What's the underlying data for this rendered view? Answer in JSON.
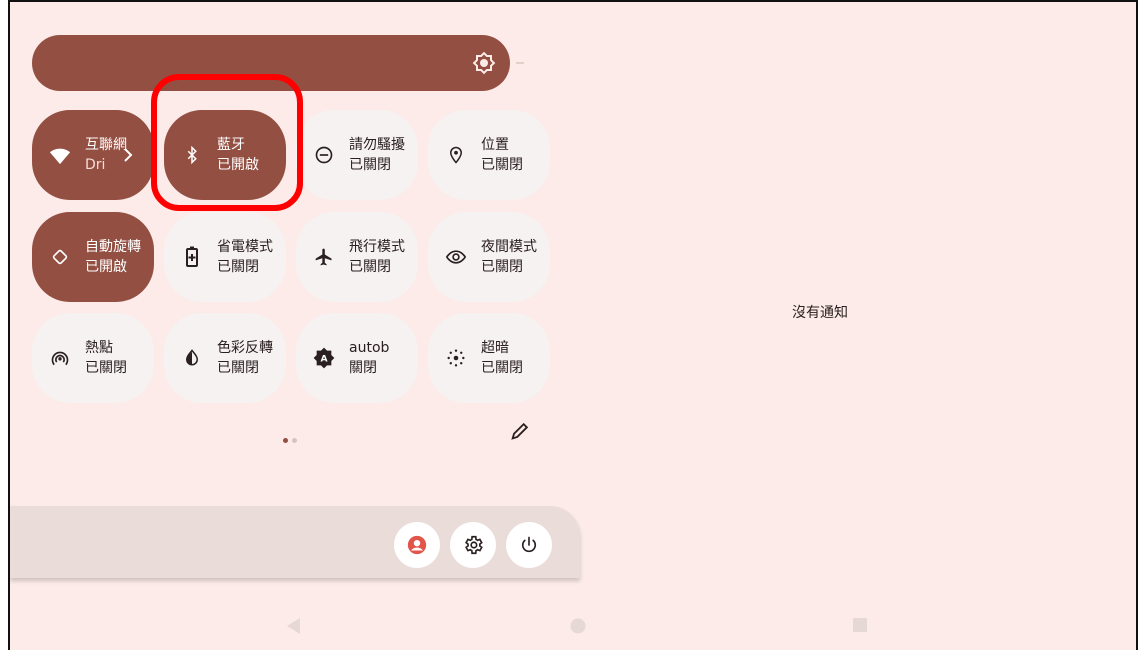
{
  "brightness": {
    "icon": "brightness-icon",
    "level": 1.0
  },
  "tiles": [
    {
      "id": "internet",
      "line1": "互聯網",
      "line2": "Dri",
      "state": "on",
      "icon": "wifi-icon",
      "has_chevron": true
    },
    {
      "id": "bluetooth",
      "line1": "藍牙",
      "line2": "已開啟",
      "state": "on",
      "icon": "bluetooth-icon"
    },
    {
      "id": "dnd",
      "line1": "請勿騷擾",
      "line2": "已關閉",
      "state": "off",
      "icon": "do-not-disturb-icon"
    },
    {
      "id": "location",
      "line1": "位置",
      "line2": "已關閉",
      "state": "off",
      "icon": "location-pin-icon"
    },
    {
      "id": "autorotate",
      "line1": "自動旋轉",
      "line2": "已開啟",
      "state": "on",
      "icon": "auto-rotate-icon"
    },
    {
      "id": "battery",
      "line1": "省電模式",
      "line2": "已關閉",
      "state": "off",
      "icon": "battery-saver-icon"
    },
    {
      "id": "airplane",
      "line1": "飛行模式",
      "line2": "已關閉",
      "state": "off",
      "icon": "airplane-icon"
    },
    {
      "id": "night",
      "line1": "夜間模式",
      "line2": "已關閉",
      "state": "off",
      "icon": "eye-icon"
    },
    {
      "id": "hotspot",
      "line1": "熱點",
      "line2": "已關閉",
      "state": "off",
      "icon": "hotspot-icon"
    },
    {
      "id": "invert",
      "line1": "色彩反轉",
      "line2": "已關閉",
      "state": "off",
      "icon": "color-invert-icon"
    },
    {
      "id": "autob",
      "line1": "autob",
      "line2": "關閉",
      "state": "off",
      "icon": "auto-brightness-icon"
    },
    {
      "id": "extradim",
      "line1": "超暗",
      "line2": "已關閉",
      "state": "off",
      "icon": "extra-dim-icon"
    }
  ],
  "pager": {
    "pages": 2,
    "current": 1
  },
  "edit": {
    "icon": "pencil-icon"
  },
  "footer": {
    "buttons": [
      "user-icon",
      "settings-gear-icon",
      "power-icon"
    ]
  },
  "notifications": {
    "empty_text": "沒有通知"
  },
  "nav": {
    "buttons": [
      "back-icon",
      "home-icon",
      "recents-icon"
    ]
  },
  "colors": {
    "accent": "#934f42",
    "background": "#fcebe8",
    "tile_off": "#f6f2f1",
    "highlight": "#ff0000"
  }
}
